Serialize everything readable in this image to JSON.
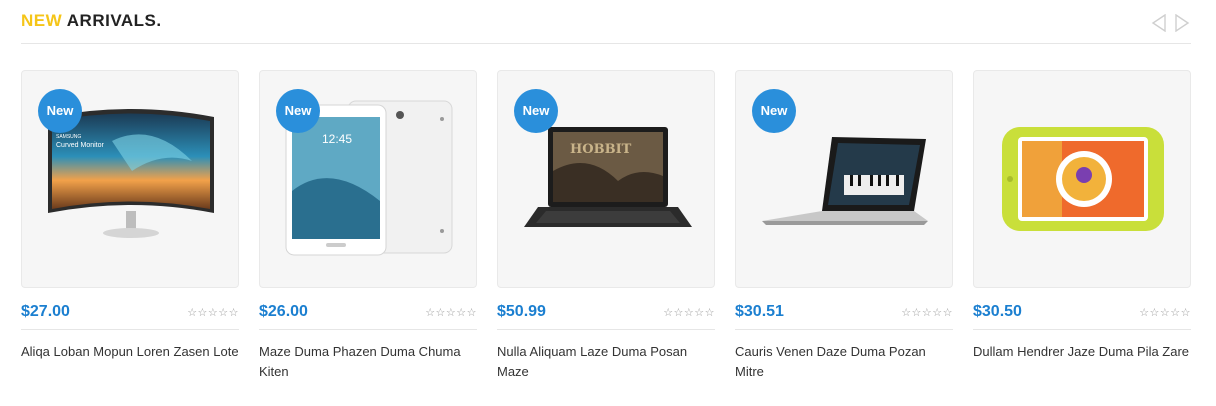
{
  "section": {
    "title_accent": "NEW",
    "title_rest": "ARRIVALS.",
    "prev_icon": "chevron-left-icon",
    "next_icon": "chevron-right-icon"
  },
  "colors": {
    "accent": "#f5c518",
    "price": "#1b7fd0",
    "badge": "#2a8fdb"
  },
  "products": [
    {
      "badge": "New",
      "price": "$27.00",
      "rating": "☆☆☆☆☆",
      "name": "Aliqa Loban Mopun Loren Zasen Lote",
      "image": "curved-monitor"
    },
    {
      "badge": "New",
      "price": "$26.00",
      "rating": "☆☆☆☆☆",
      "name": "Maze Duma Phazen Duma Chuma Kiten",
      "image": "tablet"
    },
    {
      "badge": "New",
      "price": "$50.99",
      "rating": "☆☆☆☆☆",
      "name": "Nulla Aliquam Laze Duma Posan Maze",
      "image": "laptop"
    },
    {
      "badge": "New",
      "price": "$30.51",
      "rating": "☆☆☆☆☆",
      "name": "Cauris Venen Daze Duma Pozan Mitre",
      "image": "laptop-piano"
    },
    {
      "badge": "",
      "price": "$30.50",
      "rating": "☆☆☆☆☆",
      "name": "Dullam Hendrer Jaze Duma Pila Zare",
      "image": "kids-tablet"
    }
  ]
}
